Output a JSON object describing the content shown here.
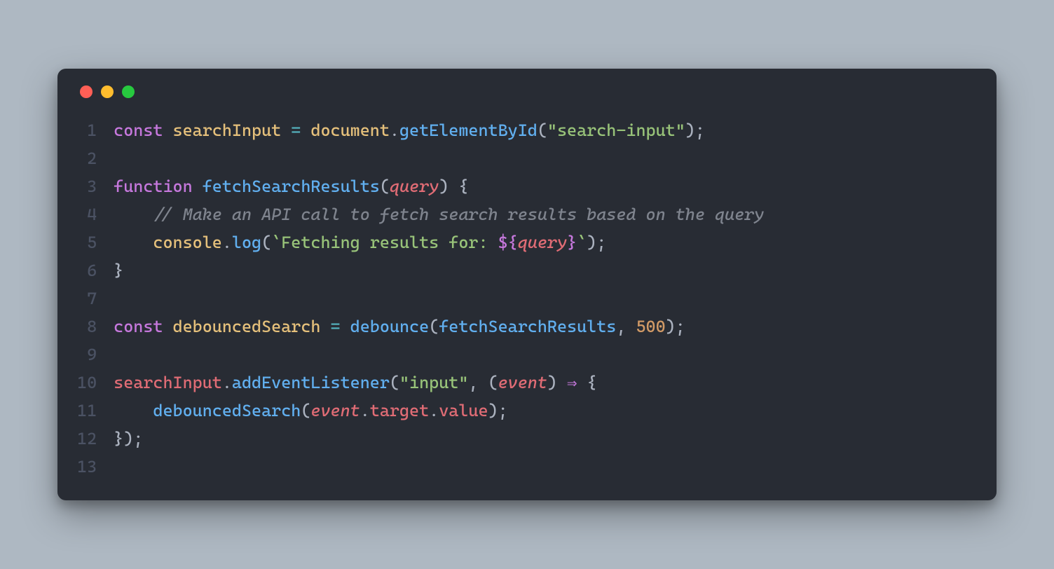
{
  "window": {
    "traffic_lights": [
      "red",
      "yellow",
      "green"
    ]
  },
  "code": {
    "line_numbers": [
      "1",
      "2",
      "3",
      "4",
      "5",
      "6",
      "7",
      "8",
      "9",
      "10",
      "11",
      "12",
      "13"
    ],
    "lines": [
      [
        {
          "t": "const ",
          "c": "tk-kw"
        },
        {
          "t": "searchInput ",
          "c": "tk-def"
        },
        {
          "t": "= ",
          "c": "tk-op"
        },
        {
          "t": "document",
          "c": "tk-obj"
        },
        {
          "t": ".",
          "c": "tk-p"
        },
        {
          "t": "getElementById",
          "c": "tk-fn"
        },
        {
          "t": "(",
          "c": "tk-p"
        },
        {
          "t": "\"search-input\"",
          "c": "tk-str"
        },
        {
          "t": ");",
          "c": "tk-p"
        }
      ],
      [],
      [
        {
          "t": "function ",
          "c": "tk-kw"
        },
        {
          "t": "fetchSearchResults",
          "c": "tk-fn"
        },
        {
          "t": "(",
          "c": "tk-p"
        },
        {
          "t": "query",
          "c": "tk-var"
        },
        {
          "t": ") {",
          "c": "tk-p"
        }
      ],
      [
        {
          "t": "    ",
          "c": "tk-p"
        },
        {
          "t": "// Make an API call to fetch search results based on the query",
          "c": "tk-cm"
        }
      ],
      [
        {
          "t": "    ",
          "c": "tk-p"
        },
        {
          "t": "console",
          "c": "tk-obj"
        },
        {
          "t": ".",
          "c": "tk-p"
        },
        {
          "t": "log",
          "c": "tk-fn"
        },
        {
          "t": "(",
          "c": "tk-p"
        },
        {
          "t": "`Fetching results for: ",
          "c": "tk-str"
        },
        {
          "t": "${",
          "c": "tk-pu"
        },
        {
          "t": "query",
          "c": "tk-var"
        },
        {
          "t": "}",
          "c": "tk-pu"
        },
        {
          "t": "`",
          "c": "tk-str"
        },
        {
          "t": ");",
          "c": "tk-p"
        }
      ],
      [
        {
          "t": "}",
          "c": "tk-p"
        }
      ],
      [],
      [
        {
          "t": "const ",
          "c": "tk-kw"
        },
        {
          "t": "debouncedSearch ",
          "c": "tk-def"
        },
        {
          "t": "= ",
          "c": "tk-op"
        },
        {
          "t": "debounce",
          "c": "tk-fn"
        },
        {
          "t": "(",
          "c": "tk-p"
        },
        {
          "t": "fetchSearchResults",
          "c": "tk-fn"
        },
        {
          "t": ", ",
          "c": "tk-p"
        },
        {
          "t": "500",
          "c": "tk-num"
        },
        {
          "t": ");",
          "c": "tk-p"
        }
      ],
      [],
      [
        {
          "t": "searchInput",
          "c": "tk-varn"
        },
        {
          "t": ".",
          "c": "tk-p"
        },
        {
          "t": "addEventListener",
          "c": "tk-fn"
        },
        {
          "t": "(",
          "c": "tk-p"
        },
        {
          "t": "\"input\"",
          "c": "tk-str"
        },
        {
          "t": ", (",
          "c": "tk-p"
        },
        {
          "t": "event",
          "c": "tk-var"
        },
        {
          "t": ") ",
          "c": "tk-p"
        },
        {
          "t": "⇒",
          "c": "tk-pu"
        },
        {
          "t": " {",
          "c": "tk-p"
        }
      ],
      [
        {
          "t": "    ",
          "c": "tk-p"
        },
        {
          "t": "debouncedSearch",
          "c": "tk-fn"
        },
        {
          "t": "(",
          "c": "tk-p"
        },
        {
          "t": "event",
          "c": "tk-var"
        },
        {
          "t": ".",
          "c": "tk-p"
        },
        {
          "t": "target",
          "c": "tk-varn"
        },
        {
          "t": ".",
          "c": "tk-p"
        },
        {
          "t": "value",
          "c": "tk-varn"
        },
        {
          "t": ");",
          "c": "tk-p"
        }
      ],
      [
        {
          "t": "});",
          "c": "tk-p"
        }
      ],
      []
    ]
  }
}
